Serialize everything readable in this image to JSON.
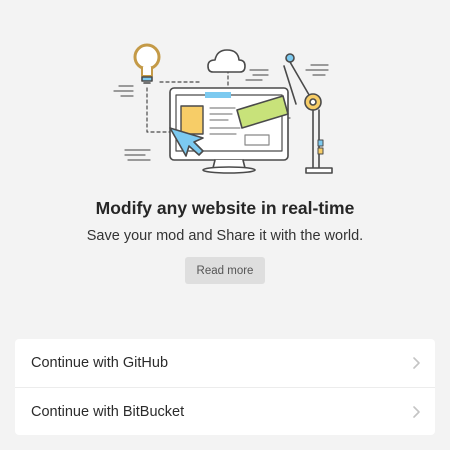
{
  "hero": {
    "headline": "Modify any website in real-time",
    "subline": "Save your mod and Share it with the world.",
    "read_more_label": "Read more"
  },
  "auth": {
    "items": [
      {
        "label": "Continue with GitHub",
        "icon": "chevron-right-icon"
      },
      {
        "label": "Continue with BitBucket",
        "icon": "chevron-right-icon"
      }
    ]
  },
  "colors": {
    "background": "#f3f3f3",
    "accent_blue": "#7ccaf0",
    "accent_yellow": "#f7cd67",
    "accent_green": "#c8e27a",
    "button_bg": "#dedede",
    "outline": "#4a4a4a"
  }
}
